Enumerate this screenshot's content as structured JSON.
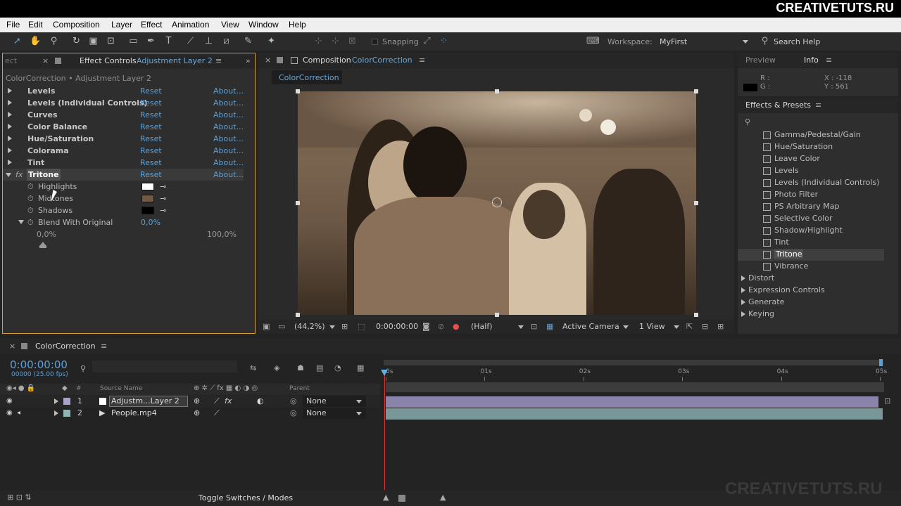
{
  "brand": "CREATIVETUTS.RU",
  "watermark": "CREATIVETUTS.RU",
  "menu": [
    "File",
    "Edit",
    "Composition",
    "Layer",
    "Effect",
    "Animation",
    "View",
    "Window",
    "Help"
  ],
  "toolbar": {
    "snapping": "Snapping",
    "workspace_label": "Workspace:",
    "workspace_value": "MyFirst",
    "search_help": "Search Help"
  },
  "effect_controls": {
    "tab_partial": "ect",
    "tab_label": "Effect Controls",
    "tab_layer": "Adjustment Layer 2",
    "breadcrumb": "ColorCorrection • Adjustment Layer 2",
    "effects": [
      {
        "name": "Levels",
        "reset": "Reset",
        "about": "About..."
      },
      {
        "name": "Levels (Individual Controls)",
        "reset": "Reset",
        "about": "About..."
      },
      {
        "name": "Curves",
        "reset": "Reset",
        "about": "About..."
      },
      {
        "name": "Color Balance",
        "reset": "Reset",
        "about": "About..."
      },
      {
        "name": "Hue/Saturation",
        "reset": "Reset",
        "about": "About..."
      },
      {
        "name": "Colorama",
        "reset": "Reset",
        "about": "About..."
      },
      {
        "name": "Tint",
        "reset": "Reset",
        "about": "About..."
      },
      {
        "name": "Tritone",
        "reset": "Reset",
        "about": "About..."
      }
    ],
    "tritone_props": {
      "highlights": "Highlights",
      "midtones": "Midtones",
      "shadows": "Shadows",
      "blend": "Blend With Original",
      "blend_value": "0,0%",
      "slider_min": "0,0%",
      "slider_max": "100,0%"
    },
    "colors": {
      "highlights": "#ffffff",
      "midtones": "#6e5a45",
      "shadows": "#000000"
    }
  },
  "composition": {
    "tab_label": "Composition",
    "tab_name": "ColorCorrection",
    "comp_tab": "ColorCorrection",
    "zoom": "(44,2%)",
    "time": "0:00:00:00",
    "resolution": "(Half)",
    "camera": "Active Camera",
    "view": "1 View"
  },
  "info": {
    "tab_preview": "Preview",
    "tab_info": "Info",
    "r": "R :",
    "g": "G :",
    "x": "X : -118",
    "y": "Y : 561"
  },
  "effects_presets": {
    "title": "Effects & Presets",
    "items": [
      "Gamma/Pedestal/Gain",
      "Hue/Saturation",
      "Leave Color",
      "Levels",
      "Levels (Individual Controls)",
      "Photo Filter",
      "PS Arbitrary Map",
      "Selective Color",
      "Shadow/Highlight",
      "Tint",
      "Tritone",
      "Vibrance"
    ],
    "categories": [
      "Distort",
      "Expression Controls",
      "Generate",
      "Keying"
    ]
  },
  "timeline": {
    "tab": "ColorCorrection",
    "timecode": "0:00:00:00",
    "fps": "00000 (25.00 fps)",
    "col_source": "Source Name",
    "col_hash": "#",
    "col_parent": "Parent",
    "ruler": [
      "0s",
      "01s",
      "02s",
      "03s",
      "04s",
      "05s"
    ],
    "layers": [
      {
        "num": "1",
        "name": "Adjustm...Layer 2",
        "parent": "None"
      },
      {
        "num": "2",
        "name": "People.mp4",
        "parent": "None"
      }
    ],
    "toggle": "Toggle Switches / Modes"
  }
}
